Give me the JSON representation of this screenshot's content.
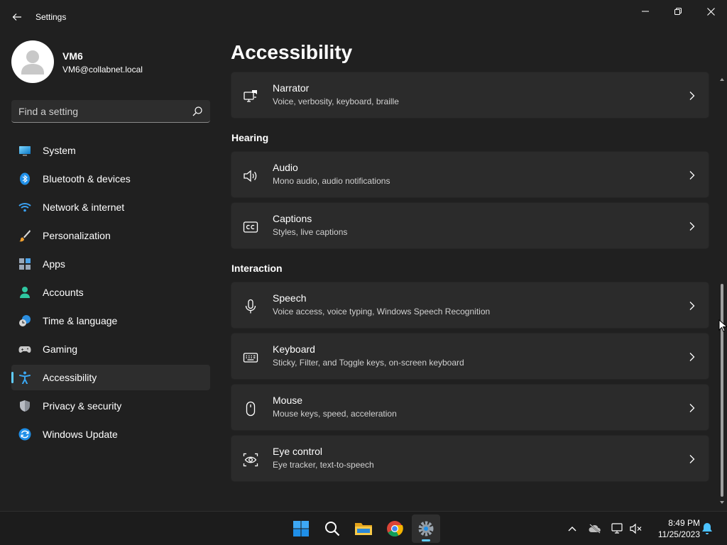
{
  "window": {
    "title": "Settings"
  },
  "profile": {
    "name": "VM6",
    "email": "VM6@collabnet.local"
  },
  "search": {
    "placeholder": "Find a setting"
  },
  "sidebar": {
    "items": [
      {
        "label": "System",
        "icon": "system-icon"
      },
      {
        "label": "Bluetooth & devices",
        "icon": "bluetooth-icon"
      },
      {
        "label": "Network & internet",
        "icon": "wifi-icon"
      },
      {
        "label": "Personalization",
        "icon": "brush-icon"
      },
      {
        "label": "Apps",
        "icon": "apps-icon"
      },
      {
        "label": "Accounts",
        "icon": "accounts-icon"
      },
      {
        "label": "Time & language",
        "icon": "time-language-icon"
      },
      {
        "label": "Gaming",
        "icon": "gamepad-icon"
      },
      {
        "label": "Accessibility",
        "icon": "accessibility-icon",
        "active": true
      },
      {
        "label": "Privacy & security",
        "icon": "shield-icon"
      },
      {
        "label": "Windows Update",
        "icon": "windows-update-icon"
      }
    ]
  },
  "main": {
    "title": "Accessibility",
    "narrator": {
      "title": "Narrator",
      "description": "Voice, verbosity, keyboard, braille",
      "icon": "narrator-icon"
    },
    "hearing": {
      "header": "Hearing",
      "cards": [
        {
          "title": "Audio",
          "description": "Mono audio, audio notifications",
          "icon": "speaker-icon"
        },
        {
          "title": "Captions",
          "description": "Styles, live captions",
          "icon": "captions-icon"
        }
      ]
    },
    "interaction": {
      "header": "Interaction",
      "cards": [
        {
          "title": "Speech",
          "description": "Voice access, voice typing, Windows Speech Recognition",
          "icon": "microphone-icon"
        },
        {
          "title": "Keyboard",
          "description": "Sticky, Filter, and Toggle keys, on-screen keyboard",
          "icon": "keyboard-icon"
        },
        {
          "title": "Mouse",
          "description": "Mouse keys, speed, acceleration",
          "icon": "mouse-icon"
        },
        {
          "title": "Eye control",
          "description": "Eye tracker, text-to-speech",
          "icon": "eye-control-icon"
        }
      ]
    }
  },
  "taskbar": {
    "time": "8:49 PM",
    "date": "11/25/2023",
    "apps": [
      "start-icon",
      "search-icon",
      "file-explorer-icon",
      "chrome-icon",
      "settings-icon"
    ],
    "accent": "#60cdff"
  }
}
